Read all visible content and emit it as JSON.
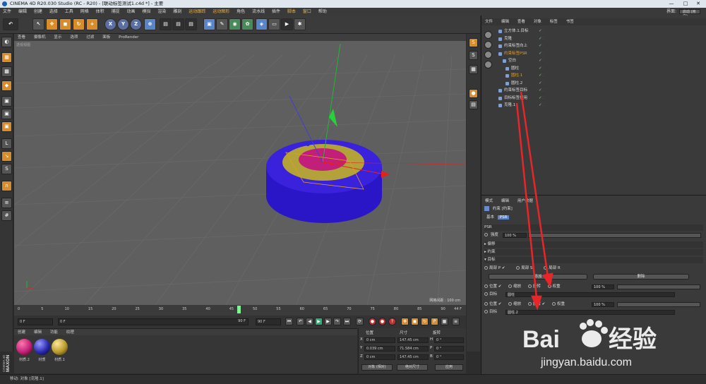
{
  "window": {
    "title": "CINEMA 4D R20.030 Studio (RC - R20) - [联动标签测试1.c4d *] - 主要",
    "min": "—",
    "max": "□",
    "close": "✕"
  },
  "menu": [
    "文件",
    "编辑",
    "创建",
    "选择",
    "工具",
    "网格",
    "体积",
    "捕捉",
    "动画",
    "模拟",
    "渲染",
    "雕刻",
    "运动跟踪",
    "运动图形",
    "角色",
    "流水线",
    "插件",
    "脚本",
    "窗口",
    "帮助"
  ],
  "layout": {
    "label": "界面:",
    "value": "启动 (用户)"
  },
  "viewport": {
    "menu": [
      "查看",
      "摄像机",
      "显示",
      "选项",
      "过滤",
      "面板",
      "ProRender"
    ],
    "camera": "透视视图",
    "grid_info": "网格间距 : 100 cm"
  },
  "timeline": {
    "ticks": [
      "0",
      "5",
      "10",
      "15",
      "20",
      "25",
      "30",
      "35",
      "40",
      "45",
      "50",
      "55",
      "60",
      "65",
      "70",
      "75",
      "80",
      "85",
      "90"
    ],
    "end": "44 F"
  },
  "playback": {
    "start": "0 F",
    "current": "0 F",
    "end": "90 F",
    "end2": "90 F"
  },
  "materials": {
    "tabs": [
      "创建",
      "编辑",
      "功能",
      "纹理"
    ],
    "items": [
      {
        "name": "材质.2",
        "color": "#c0207a"
      },
      {
        "name": "材质",
        "color": "#2a2ab0"
      },
      {
        "name": "材质.1",
        "color": "#b89a2a"
      }
    ]
  },
  "coords": {
    "headers": {
      "pos": "位置",
      "size": "尺寸",
      "rot": "旋转"
    },
    "rows": [
      {
        "axis": "X",
        "pos": "0 cm",
        "size": "147.45 cm",
        "rlabel": "H",
        "rot": "0 °"
      },
      {
        "axis": "Y",
        "pos": "0.039 cm",
        "size": "71.584 cm",
        "rlabel": "P",
        "rot": "0 °"
      },
      {
        "axis": "Z",
        "pos": "0 cm",
        "size": "147.45 cm",
        "rlabel": "B",
        "rot": "0 °"
      }
    ],
    "mode": "对象 (相对)",
    "sizemode": "绝对尺寸",
    "apply": "应用"
  },
  "objects": {
    "tabs": [
      "文件",
      "编辑",
      "查看",
      "对象",
      "标签",
      "书签"
    ],
    "rows": [
      {
        "name": "立方体.1.目标",
        "indent": 0,
        "style": ""
      },
      {
        "name": "克隆",
        "indent": 0,
        "style": ""
      },
      {
        "name": "约束标签向上",
        "indent": 0,
        "style": ""
      },
      {
        "name": "约束标签PSR",
        "indent": 0,
        "style": "yel"
      },
      {
        "name": "空白",
        "indent": 6,
        "style": ""
      },
      {
        "name": "圆柱",
        "indent": 10,
        "style": ""
      },
      {
        "name": "圆柱.1",
        "indent": 10,
        "style": "yel"
      },
      {
        "name": "圆柱.2",
        "indent": 10,
        "style": ""
      },
      {
        "name": "约束标签目标",
        "indent": 0,
        "style": ""
      },
      {
        "name": "目标标签使用",
        "indent": 0,
        "style": ""
      },
      {
        "name": "克隆.1",
        "indent": 0,
        "style": ""
      }
    ]
  },
  "attributes": {
    "tabs": [
      "模式",
      "编辑",
      "用户数据"
    ],
    "title": "约束 [约束]",
    "subtabs": [
      "基本",
      "PSR"
    ],
    "section": "PSR",
    "strength_label": "强度",
    "strength_value": "100 %",
    "groups": [
      "▸ 偏移",
      "▸ 约束",
      "▾ 目标"
    ],
    "checks": {
      "maintain": "局部 P",
      "r1": "局部 S",
      "r2": "局部 R"
    },
    "add": "添加",
    "remove": "删除",
    "target1": {
      "pos": "位置",
      "scale": "缩放",
      "rot": "旋转",
      "weight": "权重",
      "weight_val": "100 %",
      "target": "目标",
      "target_val": "圆柱"
    },
    "target2": {
      "pos": "位置",
      "scale": "缩放",
      "rot": "旋转",
      "weight": "权重",
      "weight_val": "100 %",
      "target": "目标",
      "target_val": "圆柱.2"
    }
  },
  "statusbar": "移动: 对象 [克隆.1]",
  "watermark": {
    "text": "Bai du 经验",
    "url": "jingyan.baidu.com"
  },
  "icons": [
    "undo-icon",
    "select-icon",
    "move-icon",
    "scale-icon",
    "rotate-icon",
    "cube-icon",
    "pen-icon",
    "film-icon",
    "light-icon",
    "camera-icon"
  ]
}
